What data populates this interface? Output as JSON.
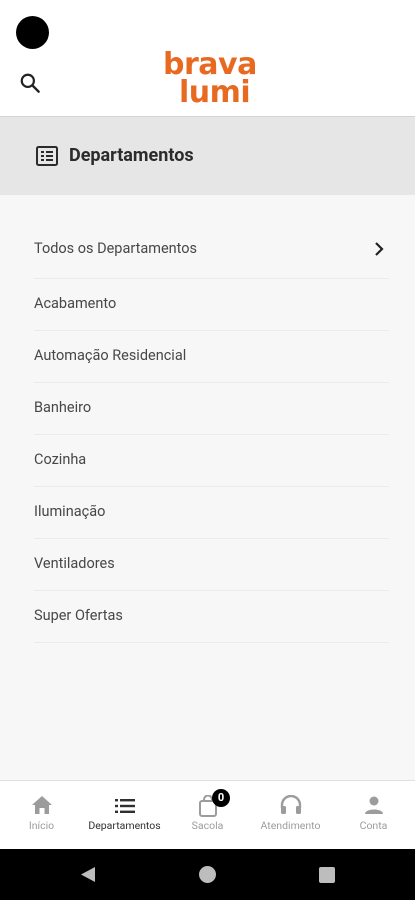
{
  "header": {
    "logo_line1": "brava",
    "logo_line2": "lumi",
    "search_icon": "search-icon",
    "brand_color": "#e86a21"
  },
  "dept_bar": {
    "title": "Departamentos",
    "icon": "list-alt-icon"
  },
  "departments": {
    "items": [
      {
        "label": "Todos os Departamentos"
      },
      {
        "label": "Acabamento"
      },
      {
        "label": "Automação Residencial"
      },
      {
        "label": "Banheiro"
      },
      {
        "label": "Cozinha"
      },
      {
        "label": "Iluminação"
      },
      {
        "label": "Ventiladores"
      },
      {
        "label": "Super Ofertas"
      }
    ]
  },
  "bottom_nav": {
    "items": [
      {
        "label": "Início",
        "icon": "home-icon"
      },
      {
        "label": "Departamentos",
        "icon": "list-icon"
      },
      {
        "label": "Sacola",
        "icon": "bag-icon"
      },
      {
        "label": "Atendimento",
        "icon": "headset-icon"
      },
      {
        "label": "Conta",
        "icon": "person-icon"
      }
    ],
    "bag_count": "0"
  }
}
